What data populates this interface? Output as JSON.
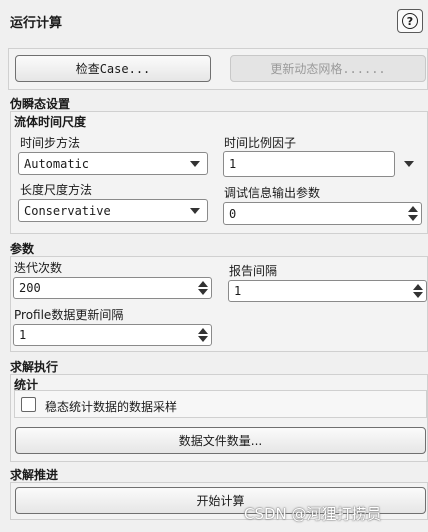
{
  "header": {
    "title": "运行计算",
    "help_glyph": "?"
  },
  "top_buttons": {
    "check_case": "检查Case...",
    "update_mesh": "更新动态网格......"
  },
  "pseudo_transient": {
    "heading": "伪瞬态设置",
    "fluid_time_scale": {
      "heading": "流体时间尺度",
      "time_step_method_label": "时间步方法",
      "time_step_method_value": "Automatic",
      "time_scale_factor_label": "时间比例因子",
      "time_scale_factor_value": "1",
      "length_scale_method_label": "长度尺度方法",
      "length_scale_method_value": "Conservative",
      "verbosity_label": "调试信息输出参数",
      "verbosity_value": "0"
    }
  },
  "parameters": {
    "heading": "参数",
    "iterations_label": "迭代次数",
    "iterations_value": "200",
    "report_interval_label": "报告间隔",
    "report_interval_value": "1",
    "profile_update_label": "Profile数据更新间隔",
    "profile_update_value": "1"
  },
  "solution_processing": {
    "heading": "求解执行",
    "statistics_heading": "统计",
    "sampling_label": "稳态统计数据的数据采样",
    "sampling_checked": false,
    "data_file_quantities": "数据文件数量..."
  },
  "solution_advancement": {
    "heading": "求解推进",
    "calculate": "开始计算"
  },
  "watermark": "CSDN @河狸打捞员"
}
